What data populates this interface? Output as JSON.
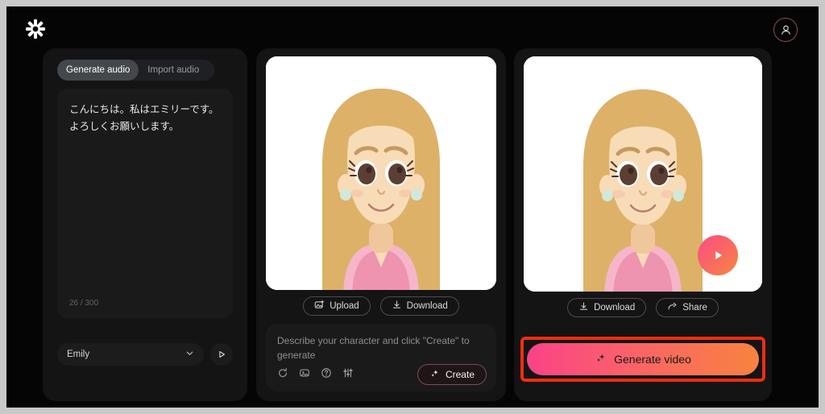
{
  "app": {
    "logo_icon": "asterisk-logo-icon",
    "account_icon": "user-avatar-icon",
    "background_color": "#050505",
    "frame_color": "#c9c9c9"
  },
  "left_panel": {
    "tabs": [
      {
        "label": "Generate audio",
        "active": true
      },
      {
        "label": "Import audio",
        "active": false
      }
    ],
    "script_text": "こんにちは。私はエミリーです。よろしくお願いします。",
    "char_count": "26 / 300",
    "voice": {
      "selected": "Emily",
      "chevron_icon": "chevron-down-icon",
      "preview_icon": "play-icon"
    }
  },
  "middle_panel": {
    "buttons": [
      {
        "label": "Upload",
        "icon": "image-upload-icon"
      },
      {
        "label": "Download",
        "icon": "download-icon"
      }
    ],
    "prompt_placeholder": "Describe your character and click \"Create\" to generate",
    "tool_icons": [
      "refresh-icon",
      "image-icon",
      "help-icon",
      "settings-sliders-icon"
    ],
    "create_button": {
      "label": "Create",
      "icon": "sparkle-icon"
    }
  },
  "right_panel": {
    "play_overlay_icon": "play-icon",
    "buttons": [
      {
        "label": "Download",
        "icon": "download-icon"
      },
      {
        "label": "Share",
        "icon": "share-arrow-icon"
      }
    ],
    "generate_button": {
      "label": "Generate video",
      "icon": "sparkle-icon",
      "gradient_start": "#fb4287",
      "gradient_end": "#f8833f",
      "highlight_color": "#f02d10"
    }
  },
  "character_art": {
    "hair_color": "#ddb168",
    "skin_color": "#f8dcb8",
    "shirt_color": "#f5b6ca",
    "collar_color": "#ee93b0",
    "eye_color": "#5b3f33",
    "earring_color": "#cfe9dc"
  }
}
